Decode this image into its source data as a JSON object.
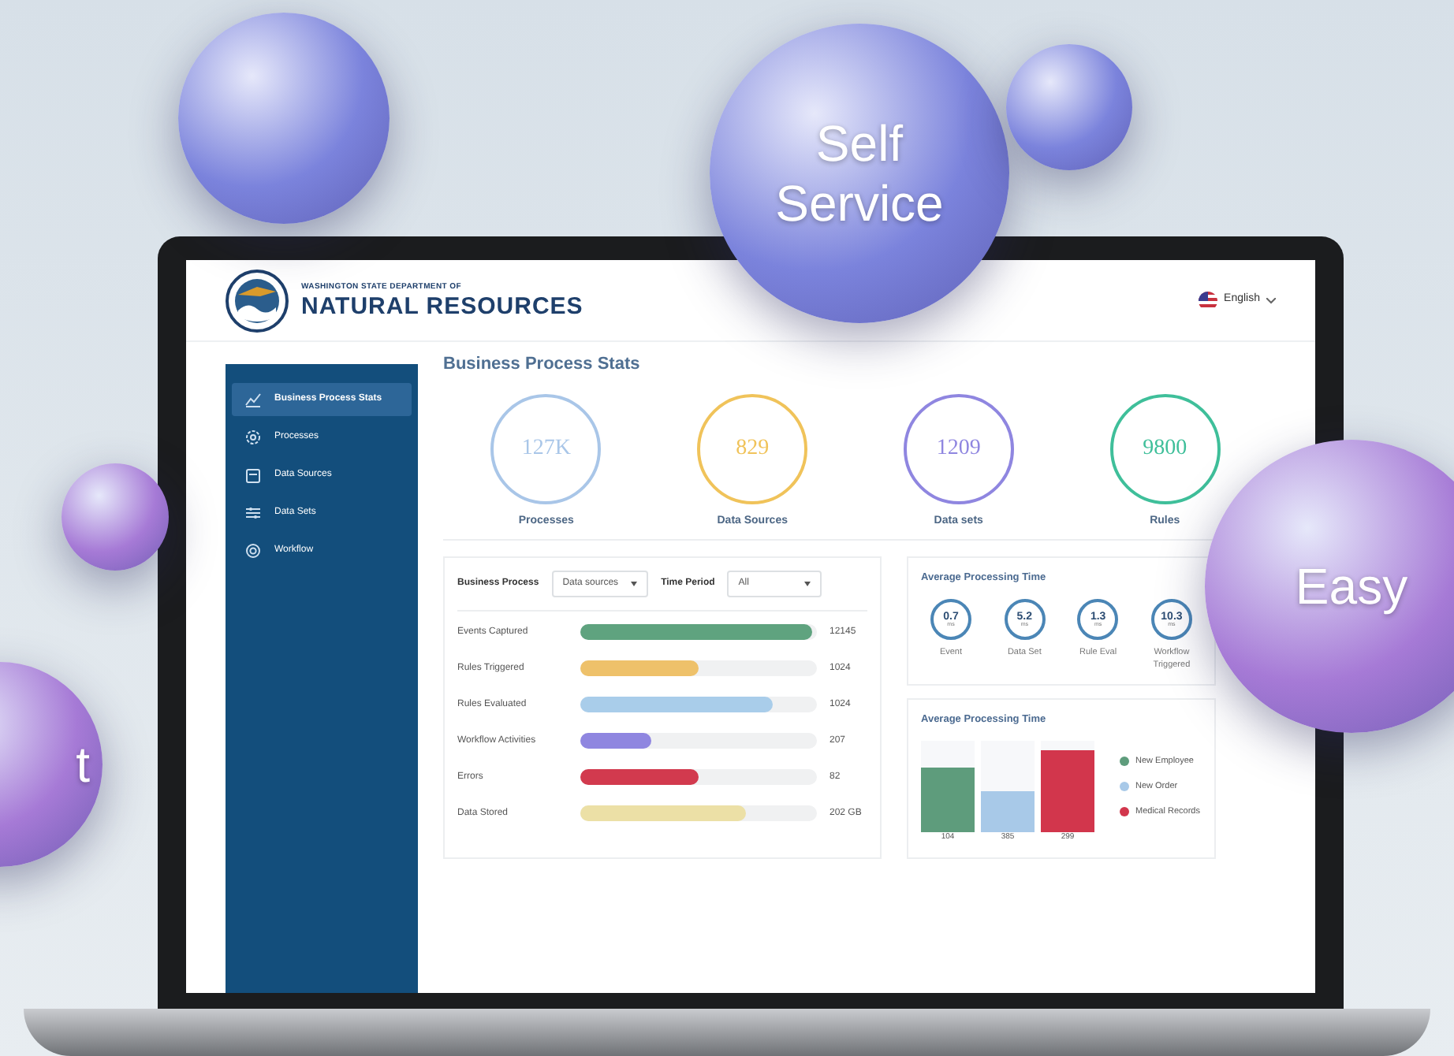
{
  "bubbles": [
    {
      "color": "#7b83dc"
    },
    {
      "text": "Self Service",
      "color": "#7b83dc"
    },
    {
      "color": "#7b83dc"
    },
    {
      "color": "#a67ad6"
    },
    {
      "text": "Easy",
      "color": "#a67ad6"
    },
    {
      "text": "t",
      "color": "#a67ad6"
    }
  ],
  "header": {
    "org_small": "WASHINGTON STATE DEPARTMENT OF",
    "org_name": "NATURAL RESOURCES",
    "language": "English"
  },
  "sidebar": {
    "items": [
      {
        "label": "Business Process Stats",
        "selected": true
      },
      {
        "label": "Processes",
        "selected": false
      },
      {
        "label": "Data Sources",
        "selected": false
      },
      {
        "label": "Data Sets",
        "selected": false
      },
      {
        "label": "Workflow",
        "selected": false
      }
    ]
  },
  "page_title": "Business Process Stats",
  "stats": [
    {
      "value": "127K",
      "label": "Processes",
      "color": "#a9c6e8"
    },
    {
      "value": "829",
      "label": "Data Sources",
      "color": "#f0c35a"
    },
    {
      "value": "1209",
      "label": "Data sets",
      "color": "#8f86e0"
    },
    {
      "value": "9800",
      "label": "Rules",
      "color": "#3fbf9a"
    }
  ],
  "filters": [
    {
      "label": "Business Process",
      "value": "Data sources"
    },
    {
      "label": "Time Period",
      "value": "All"
    }
  ],
  "metrics": [
    {
      "label": "Events Captured",
      "level": 0.98,
      "value": "12145",
      "color": "#5fa37f"
    },
    {
      "label": "Rules Triggered",
      "level": 0.5,
      "value": "1024",
      "color": "#eec16a"
    },
    {
      "label": "Rules Evaluated",
      "level": 0.81,
      "value": "1024",
      "color": "#a9cdea"
    },
    {
      "label": "Workflow Activities",
      "level": 0.3,
      "value": "207",
      "color": "#8f86e0"
    },
    {
      "label": "Errors",
      "level": 0.5,
      "value": "82",
      "color": "#d23a4e"
    },
    {
      "label": "Data Stored",
      "level": 0.7,
      "value": "202 GB",
      "color": "#ece0a6"
    }
  ],
  "steps_card": {
    "title": "Average Processing Time",
    "steps": [
      {
        "value": "0.7",
        "unit": "ms",
        "label": "Event"
      },
      {
        "value": "5.2",
        "unit": "ms",
        "label": "Data Set"
      },
      {
        "value": "1.3",
        "unit": "ms",
        "label": "Rule Eval"
      },
      {
        "value": "10.3",
        "unit": "ms",
        "label": "Workflow Triggered"
      }
    ]
  },
  "bars_card": {
    "title": "Average Processing Time",
    "bars": [
      {
        "name": "New Employee",
        "label": "104",
        "level": 0.7,
        "color": "#5e9c7c"
      },
      {
        "name": "New Order",
        "label": "385",
        "level": 0.44,
        "color": "#a8c9e8"
      },
      {
        "name": "Medical Records",
        "label": "299",
        "level": 0.9,
        "color": "#d2364c"
      }
    ]
  }
}
